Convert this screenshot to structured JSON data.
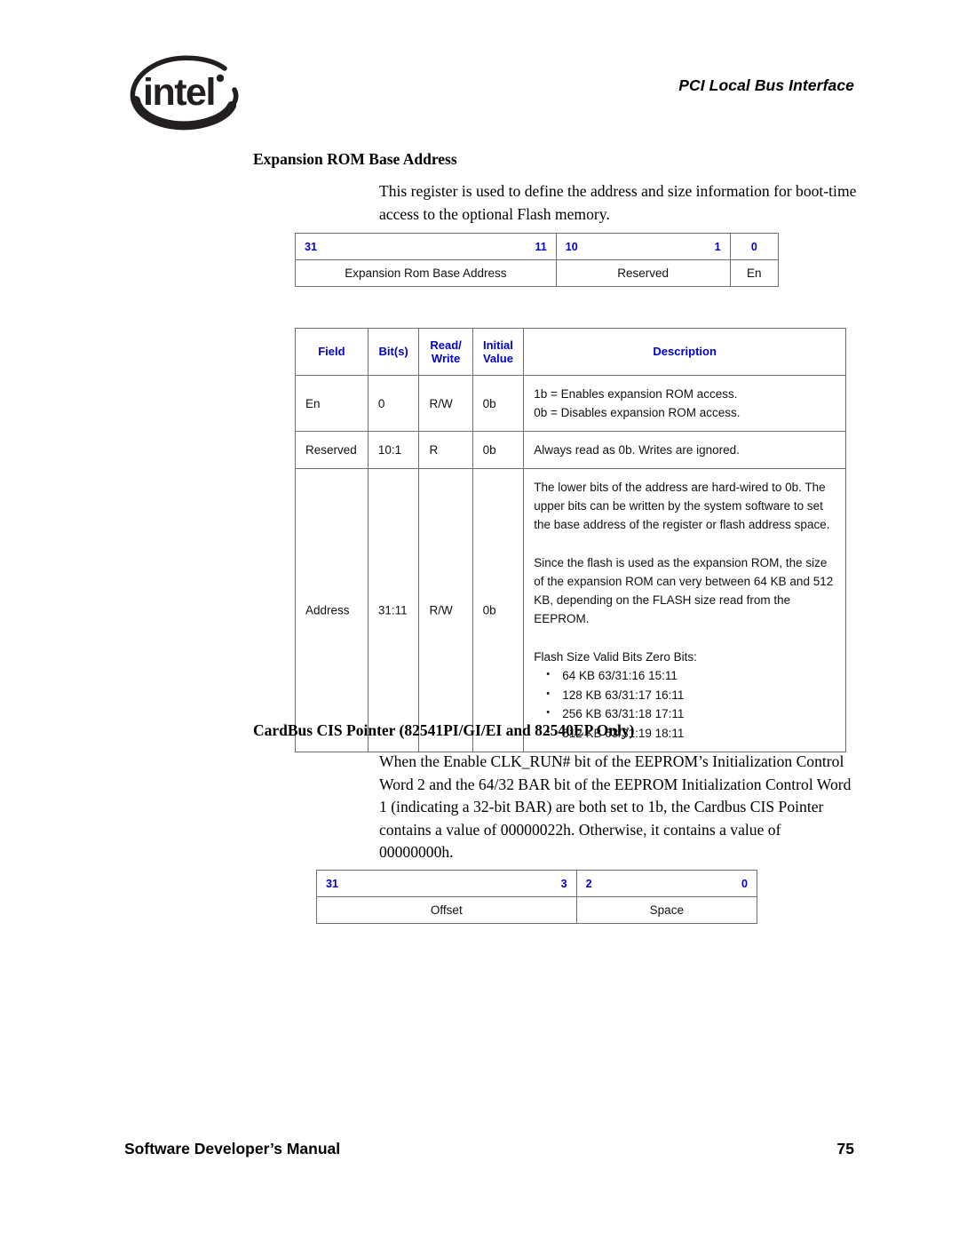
{
  "header": {
    "logo_name": "intel",
    "logo_trademark": "®",
    "title": "PCI Local Bus Interface"
  },
  "footer": {
    "title": "Software Developer’s Manual",
    "page_number": "75"
  },
  "colors": {
    "table_header_blue": "#0000d0",
    "border_gray": "#6e6e6e",
    "text_black": "#000000"
  },
  "sections": [
    {
      "heading": "Expansion ROM Base Address",
      "paragraph": "This register is used to define the address and size information for boot-time access to the optional Flash memory."
    },
    {
      "heading": "CardBus CIS Pointer (82541PI/GI/EI and 82540EP Only)",
      "paragraph": "When the Enable CLK_RUN# bit of the EEPROM’s Initialization Control Word 2 and the 64/32 BAR bit of the EEPROM Initialization Control Word 1 (indicating a 32-bit BAR) are both set to 1b, the Cardbus CIS Pointer contains a value of 00000022h. Otherwise, it contains a value of 00000000h."
    }
  ],
  "bit_table_expansion_rom": {
    "fields": [
      {
        "bit_high": "31",
        "bit_low": "11",
        "name": "Expansion Rom Base Address",
        "width_pct": 54
      },
      {
        "bit_high": "10",
        "bit_low": "1",
        "name": "Reserved",
        "width_pct": 36
      },
      {
        "bit_high": "0",
        "bit_low": "",
        "name": "En",
        "width_pct": 10
      }
    ]
  },
  "bit_table_cardbus": {
    "fields": [
      {
        "bit_high": "31",
        "bit_low": "3",
        "name": "Offset",
        "width_pct": 59
      },
      {
        "bit_high": "2",
        "bit_low": "0",
        "name": "Space",
        "width_pct": 41
      }
    ]
  },
  "field_table": {
    "columns": [
      "Field",
      "Bit(s)",
      "Read/ Write",
      "Initial Value",
      "Description"
    ],
    "columns_split": [
      [
        "Field"
      ],
      [
        "Bit(s)"
      ],
      [
        "Read/",
        "Write"
      ],
      [
        "Initial",
        "Value"
      ],
      [
        "Description"
      ]
    ],
    "rows": [
      {
        "field": "En",
        "bits": "0",
        "read_write": "R/W",
        "initial_value": "0b",
        "description_lines": [
          "1b = Enables expansion ROM access.",
          "0b = Disables expansion ROM access."
        ]
      },
      {
        "field": "Reserved",
        "bits": "10:1",
        "read_write": "R",
        "initial_value": "0b",
        "description_lines": [
          "Always read as 0b. Writes are ignored."
        ]
      },
      {
        "field": "Address",
        "bits": "31:11",
        "read_write": "R/W",
        "initial_value": "0b",
        "description_paragraph_1": "The lower bits of the address are hard-wired to 0b. The upper bits can be written by the system software to set the base address of the register or flash address space.",
        "description_paragraph_2": "Since the flash is used as the expansion ROM, the size of the expansion ROM can very between 64 KB and 512 KB, depending on the FLASH size read from the EEPROM.",
        "description_list_title": "Flash Size Valid Bits Zero Bits:",
        "description_bullets": [
          "64 KB 63/31:16 15:11",
          "128 KB 63/31:17 16:11",
          "256 KB 63/31:18 17:11",
          "512 KB 63/31:19 18:11"
        ]
      }
    ]
  }
}
